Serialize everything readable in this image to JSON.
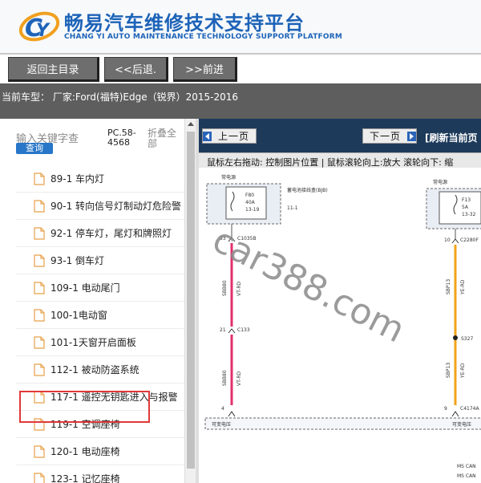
{
  "header": {
    "title": "畅易汽车维修技术支持平台",
    "subtitle": "CHANG YI AUTO MAINTENANCE TECHNOLOGY SUPPORT PLATFORM",
    "logo_icon": "cy-logo-icon"
  },
  "nav": {
    "home": "返回主目录",
    "back": "<<后退.",
    "forward": ">>前进"
  },
  "model_bar": {
    "text": "当前车型：  厂家:Ford(福特)Edge（锐界）2015-2016"
  },
  "search": {
    "placeholder": "输入关键字查",
    "query_button": "查询",
    "pc_code": "PC.58-4568",
    "collapse_all": "折叠全部"
  },
  "tree": {
    "items": [
      {
        "label": "89-1 车内灯"
      },
      {
        "label": "90-1 转向信号灯制动灯危险警"
      },
      {
        "label": "92-1 停车灯，尾灯和牌照灯"
      },
      {
        "label": "93-1 倒车灯"
      },
      {
        "label": "109-1 电动尾门"
      },
      {
        "label": "100-1电动窗"
      },
      {
        "label": "101-1天窗开启面板"
      },
      {
        "label": "112-1 被动防盗系统"
      },
      {
        "label": "117-1 遥控无钥匙进入与报警"
      },
      {
        "label": "119-1 空调座椅"
      },
      {
        "label": "120-1 电动座椅"
      },
      {
        "label": "123-1 记忆座椅"
      }
    ],
    "highlighted_index": 4
  },
  "viewer": {
    "prev": "上一页",
    "next": "下一页",
    "refresh": "[刷新当前页",
    "hint": "鼠标左右拖动: 控制图片位置 | 鼠标滚轮向上:放大  滚轮向下: 缩"
  },
  "diagram": {
    "left_label": "常电源",
    "right_label": "常电源",
    "left_fuse": [
      "F80",
      "40A",
      "13-19"
    ],
    "right_fuse": [
      "F13",
      "5A",
      "13-32"
    ],
    "left_desc": "蓄电池接线盒(BJB)",
    "left_desc_sub": "11-1",
    "pins_left": [
      "53",
      "C1035B",
      "21",
      "C133",
      "4"
    ],
    "wire_left_1": "SBB80",
    "wire_left_1_color": "VT-RD",
    "wire_left_2": "SBB80",
    "wire_left_2_color": "VT-RD",
    "pins_right": [
      "10",
      "C2280F",
      "S327",
      "9",
      "C4174A"
    ],
    "wire_right_1": "SBP13",
    "wire_right_1_color": "YE-RD",
    "wire_right_2": "SBP13",
    "wire_right_2_color": "YE-RD",
    "bottom_left_label": "可变电压",
    "bottom_right_label": "可变电压",
    "ms_can_1": "MS CAN",
    "ms_can_2": "MS CAN",
    "watermark": "car388.com",
    "colors": {
      "wire_left": "#e0306a",
      "wire_right": "#f2a21a",
      "watermark": "#8a8a8a"
    }
  }
}
